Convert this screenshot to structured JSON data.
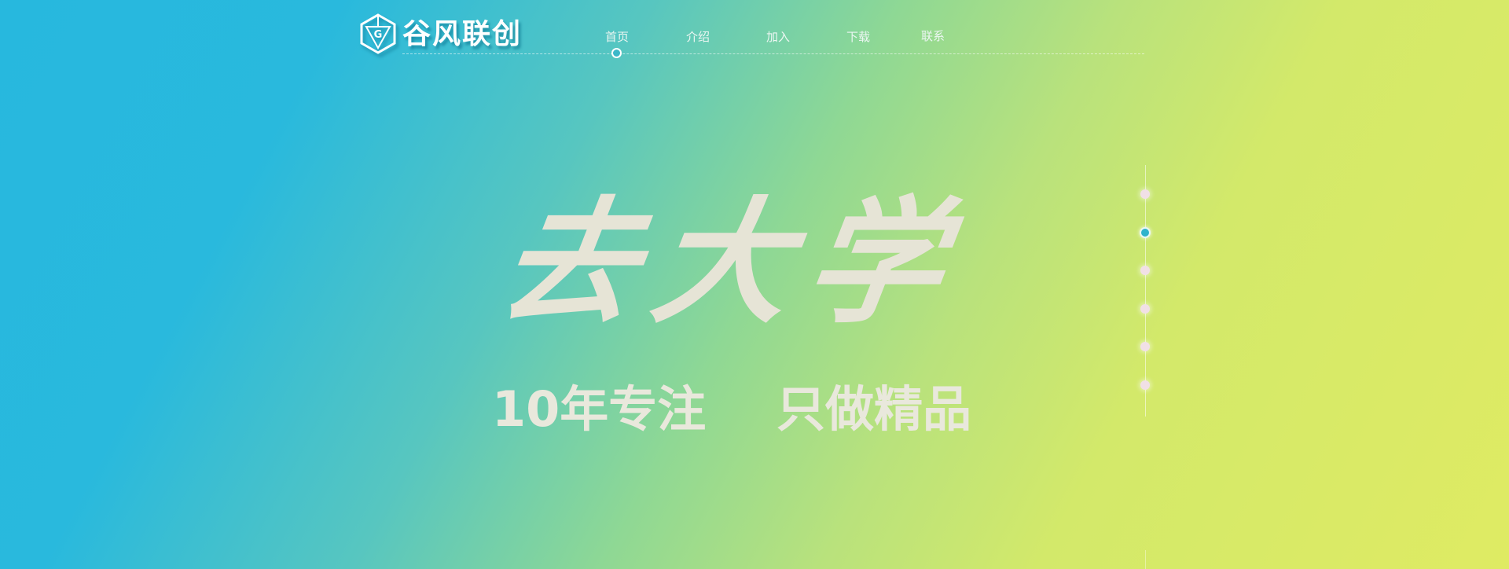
{
  "brand": {
    "logo_text": "谷风联创",
    "logo_mark_letter": "G",
    "logo_icon": "hexagon-g-logo-icon"
  },
  "nav": {
    "items": [
      {
        "label": "首页",
        "active": true
      },
      {
        "label": "介绍",
        "active": false
      },
      {
        "label": "加入",
        "active": false
      },
      {
        "label": "下载",
        "active": false
      },
      {
        "label": "联系",
        "active": false
      }
    ]
  },
  "hero": {
    "calligraphy": "去大学",
    "slogan_left": "10年专注",
    "slogan_right": "只做精品"
  },
  "pager": {
    "total": 6,
    "active_index": 1
  },
  "colors": {
    "gradient_start": "#27b8de",
    "gradient_mid": "#8fd894",
    "gradient_end": "#dfeb63",
    "hero_text": "#e6e4d6",
    "active_dot": "#2fb3cc",
    "inactive_dot": "#f1e0e6"
  }
}
